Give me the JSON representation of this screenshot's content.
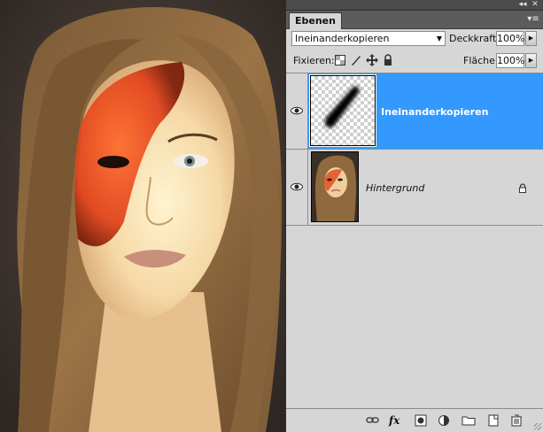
{
  "window": {
    "collapse_label": "◂◂",
    "close_label": "✕"
  },
  "panel": {
    "tab_label": "Ebenen",
    "menu_icon": "panel-menu-icon",
    "blend_mode": "Ineinanderkopieren",
    "opacity_label": "Deckkraft:",
    "opacity_value": "100%",
    "lock_label": "Fixieren:",
    "fill_label": "Fläche:",
    "fill_value": "100%",
    "lock_icons": [
      "lock-transparent-icon",
      "lock-paint-icon",
      "lock-move-icon",
      "lock-all-icon"
    ]
  },
  "layers": [
    {
      "name": "Ineinanderkopieren",
      "visible": true,
      "selected": true,
      "thumbnail": "brush-stroke-on-transparency",
      "locked": false
    },
    {
      "name": "Hintergrund",
      "visible": true,
      "selected": false,
      "thumbnail": "portrait-photo",
      "locked": true
    }
  ],
  "bottom_toolbar": {
    "icons": [
      "link-layers-icon",
      "fx-icon",
      "add-mask-icon",
      "adjustment-layer-icon",
      "new-group-icon",
      "new-layer-icon",
      "delete-layer-icon"
    ],
    "fx_label": "fx"
  },
  "colors": {
    "selection": "#3399ff",
    "panel_bg": "#d6d6d6",
    "warpaint": "#e8481c"
  }
}
